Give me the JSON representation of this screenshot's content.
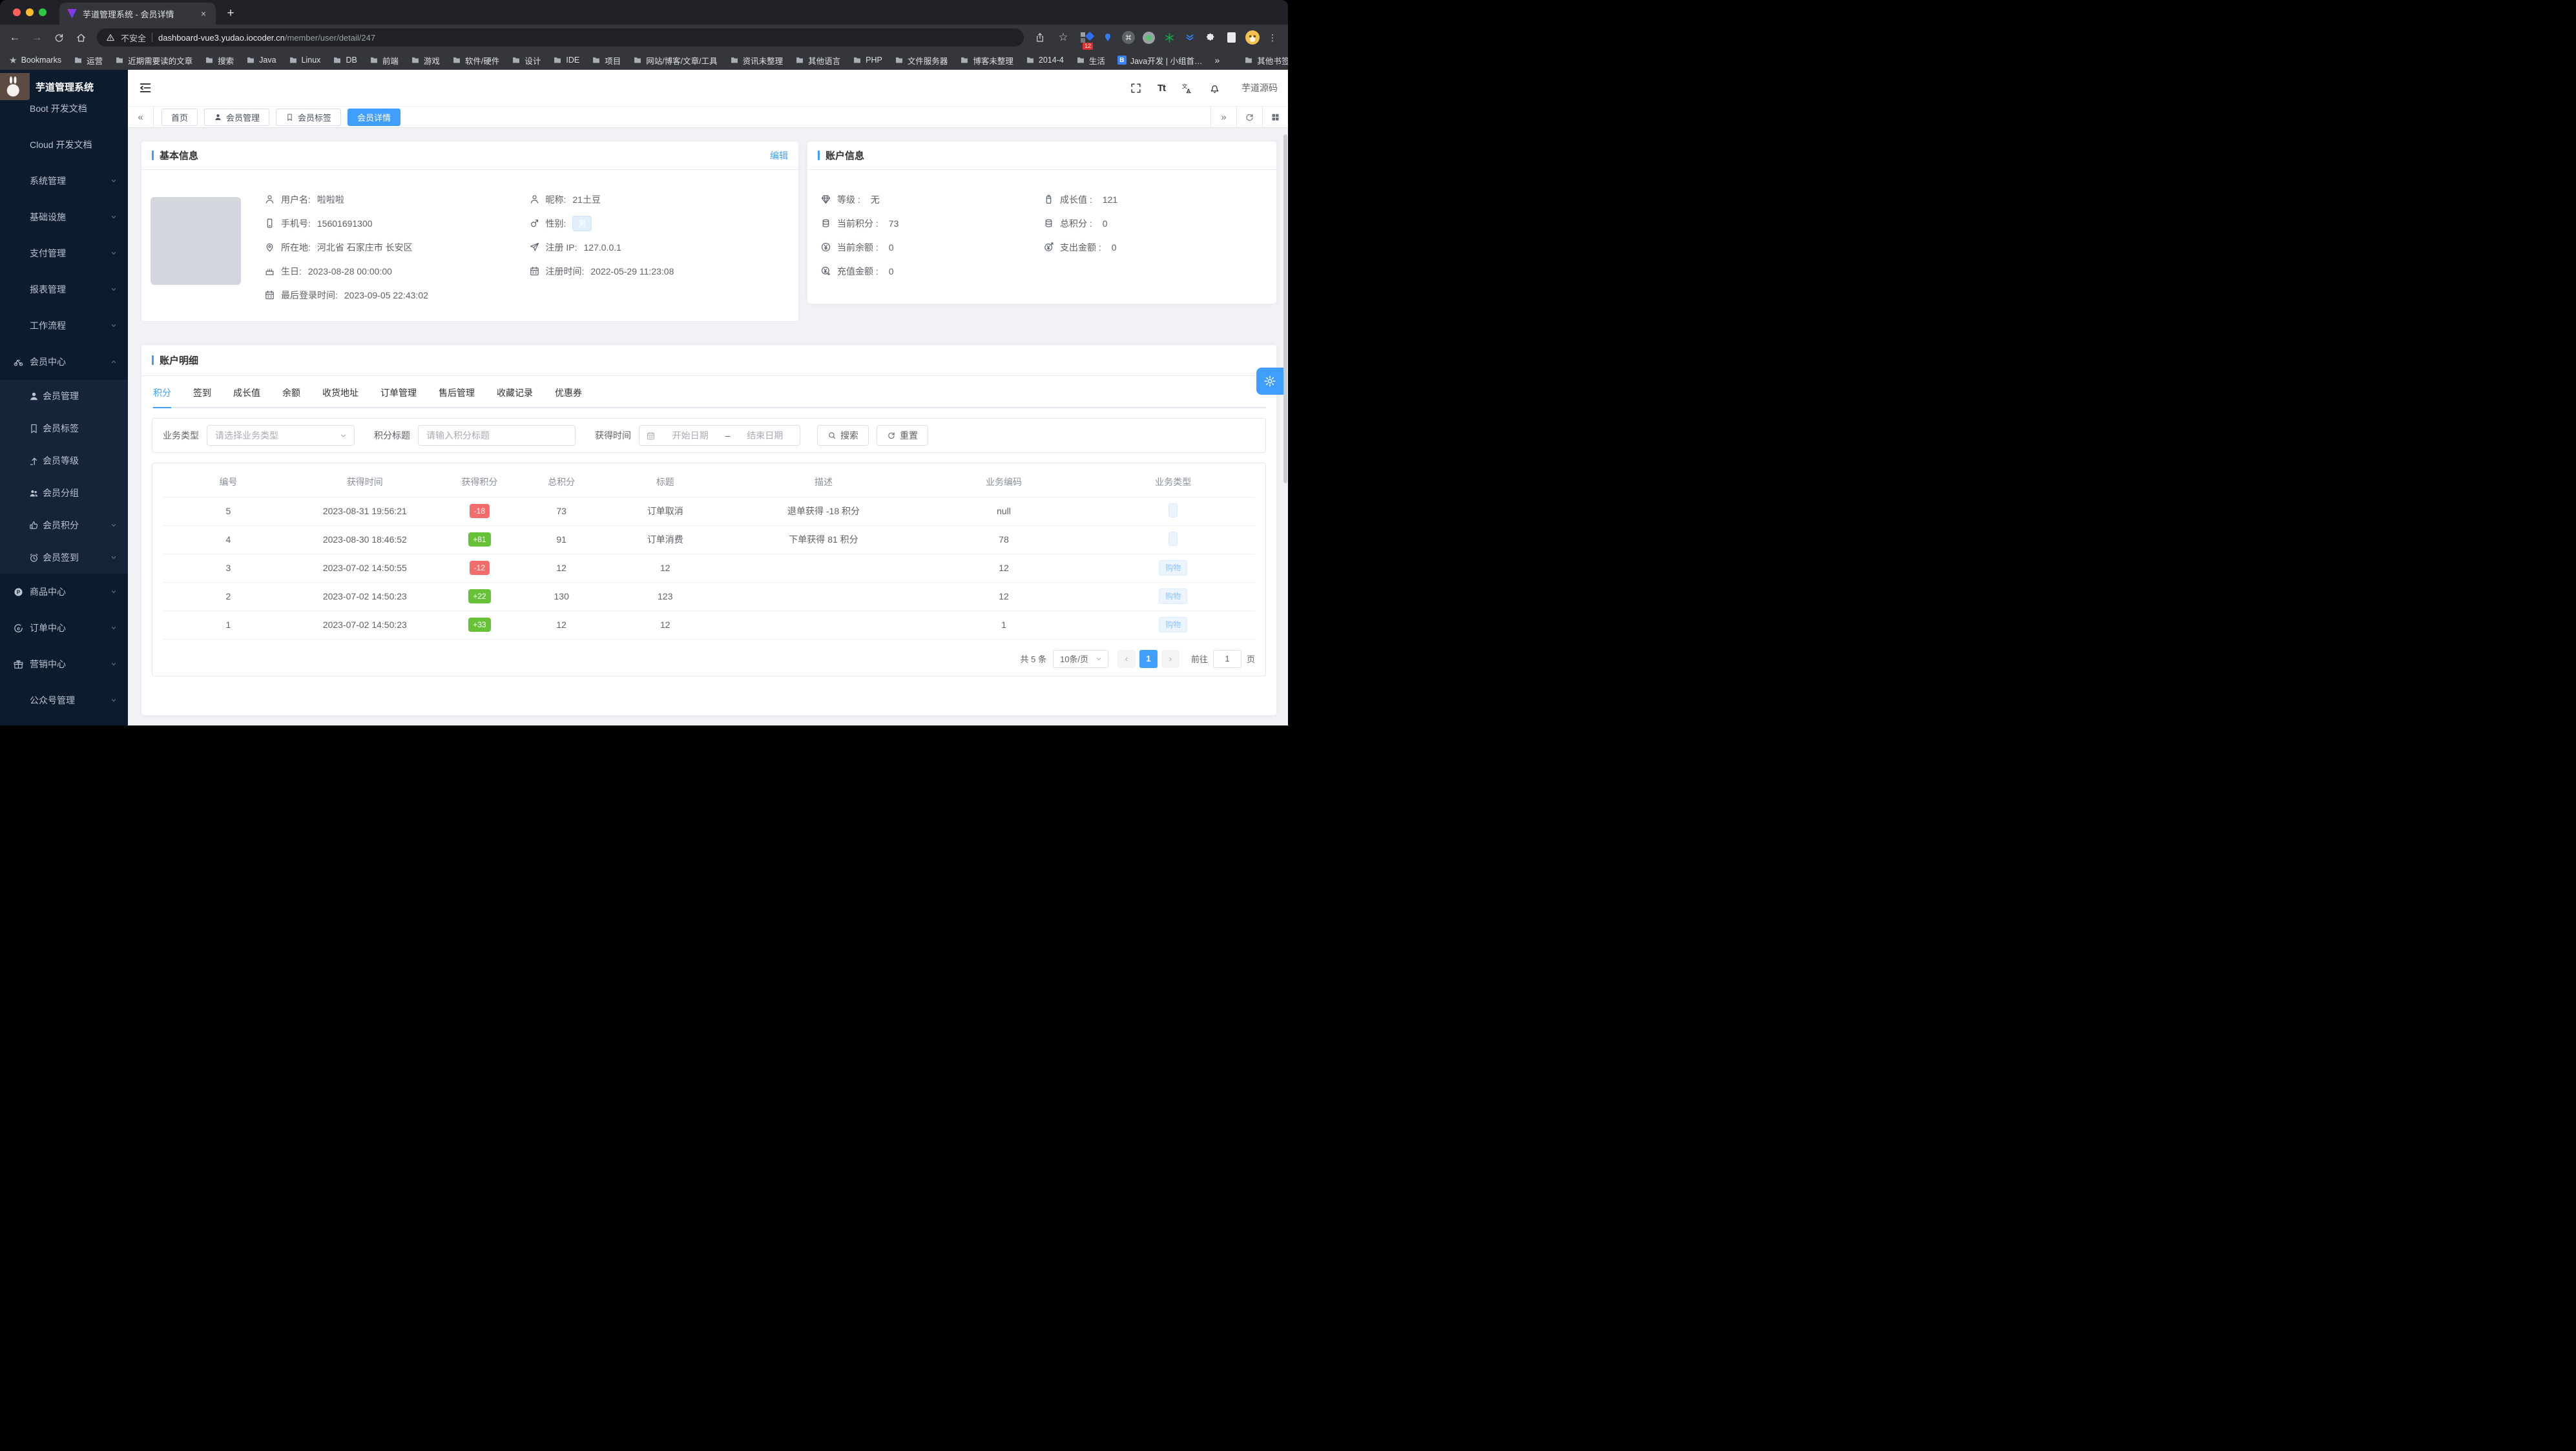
{
  "colors": {
    "accent": "#409eff",
    "danger": "#f56c6c",
    "success": "#67c23a",
    "sidebar_bg": "#0c1b2d"
  },
  "browser": {
    "tab": {
      "title": "芋道管理系统 - 会员详情"
    },
    "address": {
      "security": "不安全",
      "host": "dashboard-vue3.yudao.iocoder.cn",
      "path": "/member/user/detail/247"
    },
    "extension_badge": "12",
    "bookmarks_bar": {
      "root_label": "Bookmarks",
      "folders": [
        {
          "label": "运营"
        },
        {
          "label": "近期需要读的文章"
        },
        {
          "label": "搜索"
        },
        {
          "label": "Java"
        },
        {
          "label": "Linux"
        },
        {
          "label": "DB"
        },
        {
          "label": "前端"
        },
        {
          "label": "游戏"
        },
        {
          "label": "软件/硬件"
        },
        {
          "label": "设计"
        },
        {
          "label": "IDE"
        },
        {
          "label": "项目"
        },
        {
          "label": "网站/博客/文章/工具"
        },
        {
          "label": "资讯未整理"
        },
        {
          "label": "其他语言"
        },
        {
          "label": "PHP"
        },
        {
          "label": "文件服务器"
        },
        {
          "label": "博客未整理"
        },
        {
          "label": "2014-4"
        },
        {
          "label": "生活"
        }
      ],
      "link_item": {
        "label": "Java开发 | 小组首…",
        "badge": "B"
      },
      "overflow_icon": "»",
      "other_bookmarks": "其他书签"
    }
  },
  "sidebar": {
    "app_title": "芋道管理系统",
    "menu": [
      {
        "label": "Boot 开发文档",
        "kind": "top"
      },
      {
        "label": "Cloud 开发文档",
        "kind": "top"
      },
      {
        "label": "系统管理",
        "kind": "top",
        "chevron": "down"
      },
      {
        "label": "基础设施",
        "kind": "top",
        "chevron": "down"
      },
      {
        "label": "支付管理",
        "kind": "top",
        "chevron": "down"
      },
      {
        "label": "报表管理",
        "kind": "top",
        "chevron": "down"
      },
      {
        "label": "工作流程",
        "kind": "top",
        "chevron": "down"
      },
      {
        "label": "会员中心",
        "kind": "top",
        "icon": "bike",
        "chevron": "up"
      },
      {
        "label": "会员管理",
        "kind": "sub",
        "icon": "user-fill"
      },
      {
        "label": "会员标签",
        "kind": "sub",
        "icon": "bookmark"
      },
      {
        "label": "会员等级",
        "kind": "sub",
        "icon": "arrow-up"
      },
      {
        "label": "会员分组",
        "kind": "sub",
        "icon": "users"
      },
      {
        "label": "会员积分",
        "kind": "sub",
        "icon": "like",
        "chevron": "down"
      },
      {
        "label": "会员签到",
        "kind": "sub",
        "icon": "clock",
        "chevron": "down"
      },
      {
        "label": "商品中心",
        "kind": "top",
        "icon": "p-circle",
        "chevron": "down"
      },
      {
        "label": "订单中心",
        "kind": "top",
        "icon": "e-circle",
        "chevron": "down"
      },
      {
        "label": "营销中心",
        "kind": "top",
        "icon": "gift",
        "chevron": "down"
      },
      {
        "label": "公众号管理",
        "kind": "top",
        "chevron": "down"
      }
    ]
  },
  "workspace": {
    "collapse_icon": "«",
    "overflow_icon": "»",
    "page_tabs": [
      {
        "label": "首页"
      },
      {
        "label": "会员管理",
        "icon": "user-fill"
      },
      {
        "label": "会员标签",
        "icon": "bookmark"
      },
      {
        "label": "会员详情",
        "cls": "active"
      }
    ],
    "header": {
      "font_icon": "Tt",
      "username": "芋道源码"
    }
  },
  "basic_info": {
    "title": "基本信息",
    "edit_label": "编辑",
    "rows_left": [
      {
        "icon": "user",
        "label": "用户名:",
        "value": "啦啦啦"
      },
      {
        "icon": "phone",
        "label": "手机号:",
        "value": "15601691300"
      },
      {
        "icon": "location",
        "label": "所在地:",
        "value": "河北省 石家庄市 长安区"
      },
      {
        "icon": "cake",
        "label": "生日:",
        "value": "2023-08-28 00:00:00"
      },
      {
        "icon": "calendar",
        "label": "最后登录时间:",
        "value": "2023-09-05 22:43:02"
      }
    ],
    "rows_right": [
      {
        "icon": "user",
        "label": "昵称:",
        "value": "21土豆"
      },
      {
        "icon": "gender",
        "label": "性别:",
        "tag": "男"
      },
      {
        "icon": "send",
        "label": "注册 IP:",
        "value": "127.0.0.1"
      },
      {
        "icon": "calendar",
        "label": "注册时间:",
        "value": "2022-05-29 11:23:08"
      }
    ]
  },
  "account_info": {
    "title": "账户信息",
    "rows_left": [
      {
        "icon": "diamond",
        "label": "等级 :",
        "value": "无"
      },
      {
        "icon": "coins",
        "label": "当前积分 :",
        "value": "73"
      },
      {
        "icon": "yen",
        "label": "当前余额 :",
        "value": "0"
      },
      {
        "icon": "yen-plus",
        "label": "充值金额 :",
        "value": "0"
      }
    ],
    "rows_right": [
      {
        "icon": "jar",
        "label": "成长值 :",
        "value": "121"
      },
      {
        "icon": "coins",
        "label": "总积分 :",
        "value": "0"
      },
      {
        "icon": "yen-out",
        "label": "支出金额 :",
        "value": "0"
      }
    ]
  },
  "account_detail": {
    "title": "账户明细",
    "tabs": [
      {
        "label": "积分",
        "cls": "active"
      },
      {
        "label": "签到"
      },
      {
        "label": "成长值"
      },
      {
        "label": "余额"
      },
      {
        "label": "收货地址"
      },
      {
        "label": "订单管理"
      },
      {
        "label": "售后管理"
      },
      {
        "label": "收藏记录"
      },
      {
        "label": "优惠券"
      }
    ],
    "filter": {
      "type_label": "业务类型",
      "type_placeholder": "请选择业务类型",
      "title_label": "积分标题",
      "title_placeholder": "请输入积分标题",
      "time_label": "获得时间",
      "start_placeholder": "开始日期",
      "separator": "–",
      "end_placeholder": "结束日期",
      "search_label": "搜索",
      "reset_label": "重置"
    },
    "table": {
      "columns": [
        {
          "label": "编号"
        },
        {
          "label": "获得时间"
        },
        {
          "label": "获得积分"
        },
        {
          "label": "总积分"
        },
        {
          "label": "标题"
        },
        {
          "label": "描述"
        },
        {
          "label": "业务编码"
        },
        {
          "label": "业务类型"
        }
      ],
      "rows": [
        {
          "id": "5",
          "time": "2023-08-31 19:56:21",
          "points": "-18",
          "points_type": "danger",
          "total": "73",
          "title": "订单取消",
          "desc": "退单获得 -18 积分",
          "biz_code": "null",
          "biz_type": "",
          "biz_cls": "empty"
        },
        {
          "id": "4",
          "time": "2023-08-30 18:46:52",
          "points": "+81",
          "points_type": "success",
          "total": "91",
          "title": "订单消费",
          "desc": "下单获得 81 积分",
          "biz_code": "78",
          "biz_type": "",
          "biz_cls": "empty"
        },
        {
          "id": "3",
          "time": "2023-07-02 14:50:55",
          "points": "-12",
          "points_type": "danger",
          "total": "12",
          "title": "12",
          "desc": "",
          "biz_code": "12",
          "biz_type": "购物",
          "biz_cls": ""
        },
        {
          "id": "2",
          "time": "2023-07-02 14:50:23",
          "points": "+22",
          "points_type": "success",
          "total": "130",
          "title": "123",
          "desc": "",
          "biz_code": "12",
          "biz_type": "购物",
          "biz_cls": ""
        },
        {
          "id": "1",
          "time": "2023-07-02 14:50:23",
          "points": "+33",
          "points_type": "success",
          "total": "12",
          "title": "12",
          "desc": "",
          "biz_code": "1",
          "biz_type": "购物",
          "biz_cls": ""
        }
      ]
    },
    "pagination": {
      "total_label": "共 5 条",
      "page_size_label": "10条/页",
      "prev_icon": "‹",
      "next_icon": "›",
      "current_page": "1",
      "goto_label": "前往",
      "goto_value": "1",
      "unit_label": "页"
    }
  }
}
